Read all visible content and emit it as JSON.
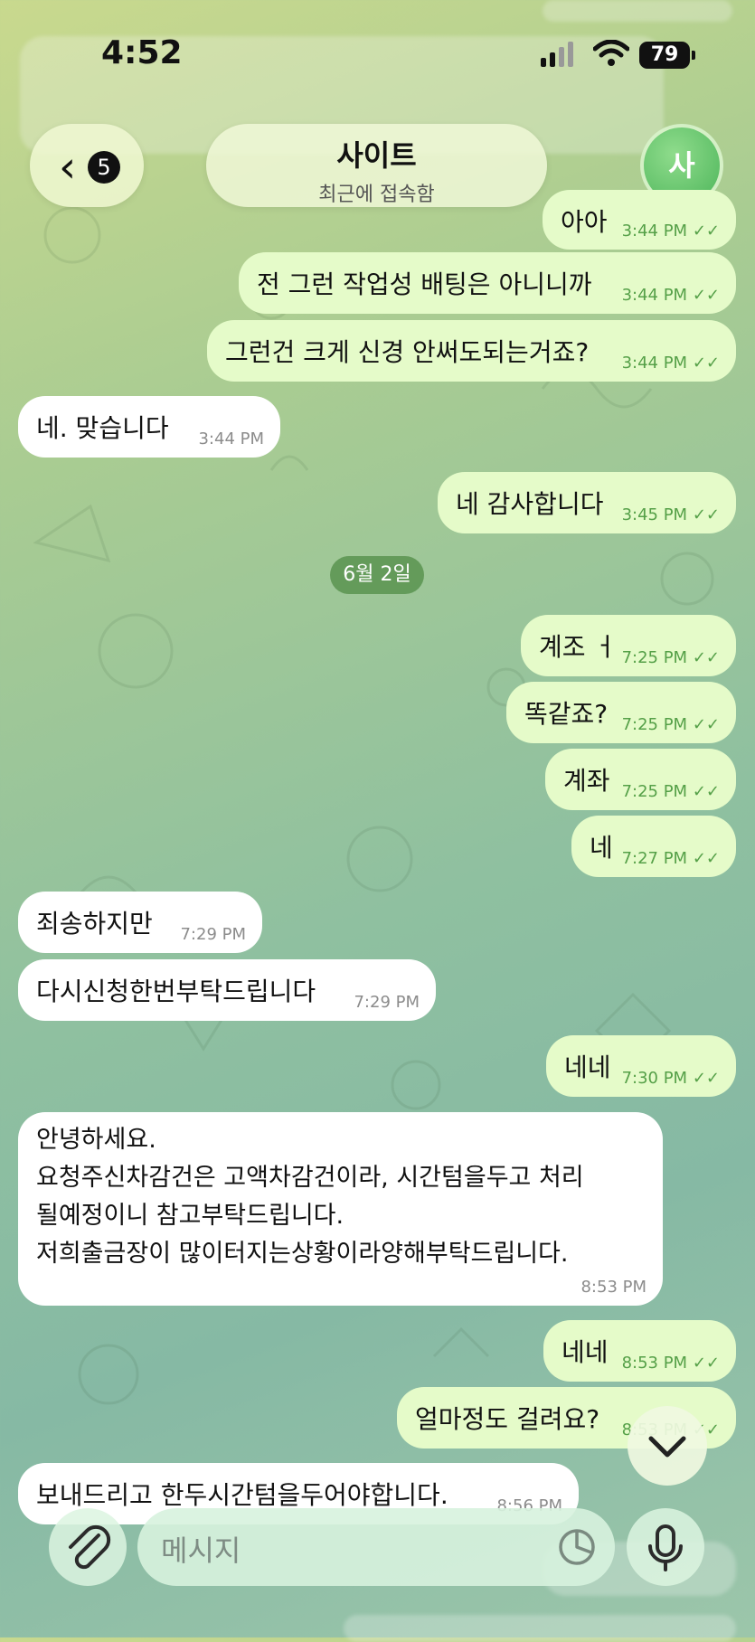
{
  "status_bar": {
    "time": "4:52",
    "battery": "79"
  },
  "header": {
    "back_count": "5",
    "contact_name": "사이트",
    "contact_status": "최근에 접속함",
    "avatar_initial": "사"
  },
  "messages": [
    {
      "dir": "out",
      "text": "아아",
      "time": "3:44 PM"
    },
    {
      "dir": "out",
      "text": "전 그런 작업성 배팅은 아니니까",
      "time": "3:44 PM"
    },
    {
      "dir": "out",
      "text": "그런건 크게 신경 안써도되는거죠?",
      "time": "3:44 PM"
    },
    {
      "dir": "in",
      "text": "네. 맞습니다",
      "time": "3:44 PM"
    },
    {
      "dir": "out",
      "text": "네 감사합니다",
      "time": "3:45 PM"
    },
    {
      "dir": "out",
      "text": "계조 ㅓ",
      "time": "7:25 PM"
    },
    {
      "dir": "out",
      "text": "똑같죠?",
      "time": "7:25 PM"
    },
    {
      "dir": "out",
      "text": "계좌",
      "time": "7:25 PM"
    },
    {
      "dir": "out",
      "text": "네",
      "time": "7:27 PM"
    },
    {
      "dir": "in",
      "text": "죄송하지만",
      "time": "7:29 PM"
    },
    {
      "dir": "in",
      "text": "다시신청한번부탁드립니다",
      "time": "7:29 PM"
    },
    {
      "dir": "out",
      "text": "네네",
      "time": "7:30 PM"
    },
    {
      "dir": "in",
      "lines": [
        "안녕하세요.",
        "요청주신차감건은 고액차감건이라, 시간텀을두고 처리",
        "될예정이니 참고부탁드립니다.",
        "저희출금장이 많이터지는상황이라양해부탁드립니다."
      ],
      "time": "8:53 PM"
    },
    {
      "dir": "out",
      "text": "네네",
      "time": "8:53 PM"
    },
    {
      "dir": "out",
      "text": "얼마정도 걸려요?",
      "time": "8:53 PM"
    },
    {
      "dir": "in",
      "text": "보내드리고 한두시간텀을두어야합니다.",
      "time": "8:56 PM"
    }
  ],
  "date_separator": "6월 2일",
  "composer": {
    "placeholder": "메시지"
  },
  "icons": {
    "back": "chevron-left-icon",
    "attach": "paperclip-icon",
    "sticker": "sticker-icon",
    "mic": "microphone-icon",
    "scroll": "chevron-down-icon",
    "read": "double-check-icon"
  }
}
